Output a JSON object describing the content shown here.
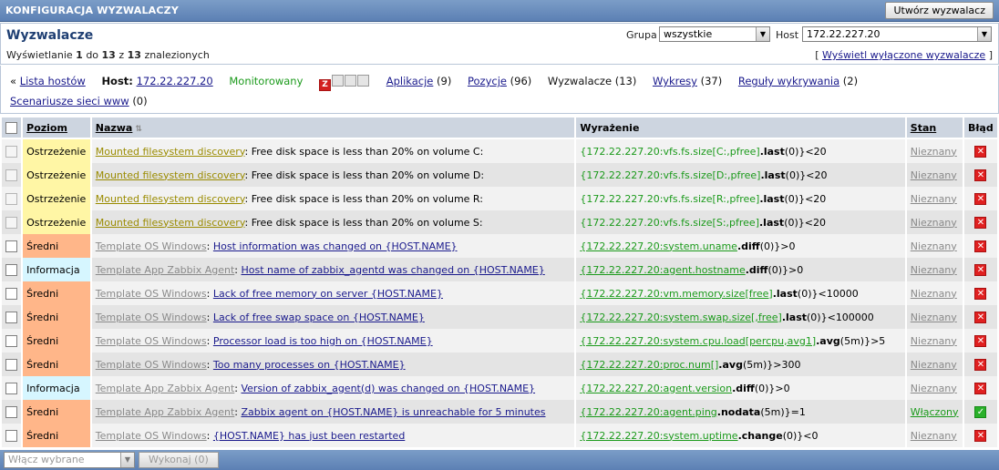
{
  "topbar": {
    "title": "KONFIGURACJA WYZWALACZY",
    "create_label": "Utwórz wyzwalacz"
  },
  "header": {
    "title": "Wyzwalacze",
    "showing_prefix": "Wyświetlanie",
    "showing_from": "1",
    "showing_to_word": "do",
    "showing_to": "13",
    "showing_of_word": "z",
    "showing_total": "13",
    "showing_suffix": "znalezionych",
    "group_label": "Grupa",
    "group_value": "wszystkie",
    "host_label": "Host",
    "host_value": "172.22.227.20",
    "toggle_link": "Wyświetl wyłączone wyzwalacze"
  },
  "hostnav": {
    "back": "Lista hostów",
    "host_label": "Host:",
    "host_name": "172.22.227.20",
    "status": "Monitorowany",
    "applications": "Aplikacje",
    "applications_count": "(9)",
    "items": "Pozycje",
    "items_count": "(96)",
    "triggers": "Wyzwalacze",
    "triggers_count": "(13)",
    "graphs": "Wykresy",
    "graphs_count": "(37)",
    "discovery": "Reguły wykrywania",
    "discovery_count": "(2)",
    "web": "Scenariusze sieci www",
    "web_count": "(0)"
  },
  "table": {
    "headers": {
      "severity": "Poziom",
      "name": "Nazwa",
      "expression": "Wyrażenie",
      "status": "Stan",
      "error": "Błąd"
    },
    "rows": [
      {
        "severity": "Ostrzeżenie",
        "sev": "warn",
        "template": "Mounted filesystem discovery",
        "name": "Free disk space is less than 20% on volume C:",
        "expr_item": "{172.22.227.20:vfs.fs.size[C:,pfree]",
        "expr_func": ".last",
        "expr_rest": "(0)}<20",
        "status": "Nieznany",
        "disabled_cb": true
      },
      {
        "severity": "Ostrzeżenie",
        "sev": "warn",
        "template": "Mounted filesystem discovery",
        "name": "Free disk space is less than 20% on volume D:",
        "expr_item": "{172.22.227.20:vfs.fs.size[D:,pfree]",
        "expr_func": ".last",
        "expr_rest": "(0)}<20",
        "status": "Nieznany",
        "disabled_cb": true
      },
      {
        "severity": "Ostrzeżenie",
        "sev": "warn",
        "template": "Mounted filesystem discovery",
        "name": "Free disk space is less than 20% on volume R:",
        "expr_item": "{172.22.227.20:vfs.fs.size[R:,pfree]",
        "expr_func": ".last",
        "expr_rest": "(0)}<20",
        "status": "Nieznany",
        "disabled_cb": true
      },
      {
        "severity": "Ostrzeżenie",
        "sev": "warn",
        "template": "Mounted filesystem discovery",
        "name": "Free disk space is less than 20% on volume S:",
        "expr_item": "{172.22.227.20:vfs.fs.size[S:,pfree]",
        "expr_func": ".last",
        "expr_rest": "(0)}<20",
        "status": "Nieznany",
        "disabled_cb": true
      },
      {
        "severity": "Średni",
        "sev": "avg",
        "template": "Template OS Windows",
        "name": "Host information was changed on {HOST.NAME}",
        "expr_item": "{172.22.227.20:system.uname",
        "expr_func": ".diff",
        "expr_rest": "(0)}>0",
        "status": "Nieznany"
      },
      {
        "severity": "Informacja",
        "sev": "info",
        "template": "Template App Zabbix Agent",
        "name": "Host name of zabbix_agentd was changed on {HOST.NAME}",
        "expr_item": "{172.22.227.20:agent.hostname",
        "expr_func": ".diff",
        "expr_rest": "(0)}>0",
        "status": "Nieznany"
      },
      {
        "severity": "Średni",
        "sev": "avg",
        "template": "Template OS Windows",
        "name": "Lack of free memory on server {HOST.NAME}",
        "expr_item": "{172.22.227.20:vm.memory.size[free]",
        "expr_func": ".last",
        "expr_rest": "(0)}<10000",
        "status": "Nieznany"
      },
      {
        "severity": "Średni",
        "sev": "avg",
        "template": "Template OS Windows",
        "name": "Lack of free swap space on {HOST.NAME}",
        "expr_item": "{172.22.227.20:system.swap.size[,free]",
        "expr_func": ".last",
        "expr_rest": "(0)}<100000",
        "status": "Nieznany"
      },
      {
        "severity": "Średni",
        "sev": "avg",
        "template": "Template OS Windows",
        "name": "Processor load is too high on {HOST.NAME}",
        "expr_item": "{172.22.227.20:system.cpu.load[percpu,avg1]",
        "expr_func": ".avg",
        "expr_rest": "(5m)}>5",
        "status": "Nieznany"
      },
      {
        "severity": "Średni",
        "sev": "avg",
        "template": "Template OS Windows",
        "name": "Too many processes on {HOST.NAME}",
        "expr_item": "{172.22.227.20:proc.num[]",
        "expr_func": ".avg",
        "expr_rest": "(5m)}>300",
        "status": "Nieznany"
      },
      {
        "severity": "Informacja",
        "sev": "info",
        "template": "Template App Zabbix Agent",
        "name": "Version of zabbix_agent(d) was changed on {HOST.NAME}",
        "expr_item": "{172.22.227.20:agent.version",
        "expr_func": ".diff",
        "expr_rest": "(0)}>0",
        "status": "Nieznany"
      },
      {
        "severity": "Średni",
        "sev": "avg",
        "template": "Template App Zabbix Agent",
        "name": "Zabbix agent on {HOST.NAME} is unreachable for 5 minutes",
        "expr_item": "{172.22.227.20:agent.ping",
        "expr_func": ".nodata",
        "expr_rest": "(5m)}=1",
        "status": "Włączony",
        "ok": true
      },
      {
        "severity": "Średni",
        "sev": "avg",
        "template": "Template OS Windows",
        "name": "{HOST.NAME} has just been restarted",
        "expr_item": "{172.22.227.20:system.uptime",
        "expr_func": ".change",
        "expr_rest": "(0)}<0",
        "status": "Nieznany"
      }
    ]
  },
  "footer": {
    "mass_placeholder": "Włącz wybrane",
    "execute_label": "Wykonaj (0)"
  }
}
